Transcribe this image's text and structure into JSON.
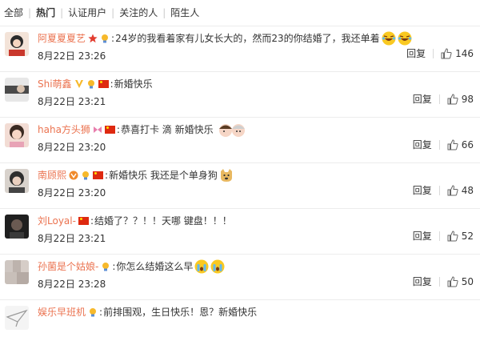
{
  "tabs": [
    "全部",
    "热门",
    "认证用户",
    "关注的人",
    "陌生人"
  ],
  "comments": [
    {
      "name": "阿夏夏夏艺",
      "text": "24岁的我看着家有儿女长大的，然而23的你结婚了，我还单着",
      "time": "8月22日 23:26",
      "reply": "回复",
      "likes": "146"
    },
    {
      "name": "Shi萌鑫",
      "text": "新婚快乐",
      "time": "8月22日 23:21",
      "reply": "回复",
      "likes": "98"
    },
    {
      "name": "haha方头狮",
      "text": "恭喜打卡 滴 新婚快乐",
      "time": "8月22日 23:20",
      "reply": "回复",
      "likes": "66"
    },
    {
      "name": "南顾熙",
      "text": "新婚快乐 我还是个单身狗",
      "time": "8月22日 23:20",
      "reply": "回复",
      "likes": "48"
    },
    {
      "name": "刘Loyal-",
      "text": "结婚了？？！！天哪 键盘！！！",
      "time": "8月22日 23:21",
      "reply": "回复",
      "likes": "52"
    },
    {
      "name": "孙菌是个姑娘-",
      "text": "你怎么结婚这么早",
      "time": "8月22日 23:28",
      "reply": "回复",
      "likes": "50"
    },
    {
      "name": "娱乐早班机",
      "text": "前排围观，生日快乐！恩？新婚快乐",
      "time": "",
      "reply": "",
      "likes": ""
    }
  ],
  "colors": {
    "nickname": "#eb7350",
    "text": "#333333",
    "divider": "#ececec"
  }
}
